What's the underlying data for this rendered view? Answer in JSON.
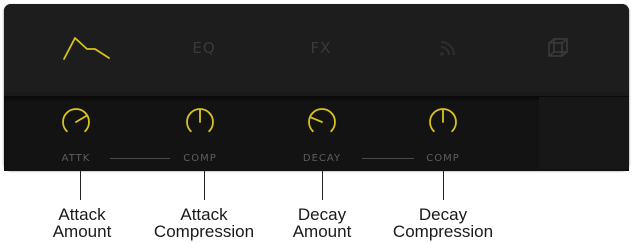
{
  "colors": {
    "accent": "#d9c31a",
    "inactive_tab": "#3a3a3c",
    "panel_bg": "#1a1a1b",
    "knob_row_bg": "#131314",
    "label_text": "#5f5f62"
  },
  "tabs": [
    {
      "name": "envelope",
      "icon": "envelope-shape-icon",
      "label": "",
      "active": true
    },
    {
      "name": "eq",
      "icon": "",
      "label": "EQ",
      "active": false
    },
    {
      "name": "fx",
      "icon": "",
      "label": "FX",
      "active": false
    },
    {
      "name": "rss",
      "icon": "rss-icon",
      "label": "",
      "active": false
    },
    {
      "name": "cube",
      "icon": "cube-icon",
      "label": "",
      "active": false
    }
  ],
  "knobs": [
    {
      "label": "ATTK",
      "level": 0.72
    },
    {
      "label": "COMP",
      "level": 0.5
    },
    {
      "label": "DECAY",
      "level": 0.25
    },
    {
      "label": "COMP",
      "level": 0.5
    }
  ],
  "callouts": [
    {
      "line1": "Attack",
      "line2": "Amount"
    },
    {
      "line1": "Attack",
      "line2": "Compression"
    },
    {
      "line1": "Decay",
      "line2": "Amount"
    },
    {
      "line1": "Decay",
      "line2": "Compression"
    }
  ]
}
